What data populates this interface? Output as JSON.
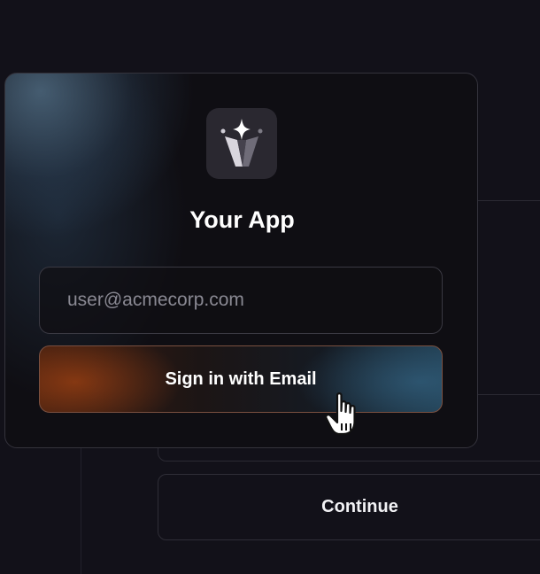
{
  "app": {
    "title": "Your App",
    "logo_icon": "crown-sparkle-icon"
  },
  "login": {
    "email_placeholder": "user@acmecorp.com",
    "signin_label": "Sign in with Email"
  },
  "background": {
    "continue_label": "Continue"
  },
  "colors": {
    "background": "#121119",
    "card": "#0f0e13",
    "accent_orange": "#c85014",
    "accent_blue": "#325f7d"
  }
}
